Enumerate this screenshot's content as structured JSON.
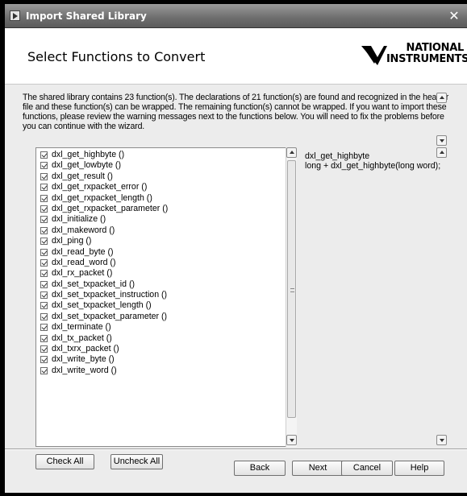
{
  "window": {
    "title": "Import Shared Library",
    "close_glyph": "✕"
  },
  "header": {
    "page_title": "Select Functions to Convert",
    "logo_line1": "NATIONAL",
    "logo_line2": "INSTRUMENTS"
  },
  "description": "The shared library contains 23 function(s). The declarations of 21 function(s) are found and recognized in the header file and these function(s) can be wrapped. The remaining function(s) cannot be wrapped. If you want to import these functions, please review the warning messages next to the functions below. You will need to fix the problems before you can continue with the wizard.",
  "functions": [
    {
      "label": "dxl_get_highbyte ()",
      "checked": true
    },
    {
      "label": "dxl_get_lowbyte ()",
      "checked": true
    },
    {
      "label": "dxl_get_result ()",
      "checked": true
    },
    {
      "label": "dxl_get_rxpacket_error ()",
      "checked": true
    },
    {
      "label": "dxl_get_rxpacket_length ()",
      "checked": true
    },
    {
      "label": "dxl_get_rxpacket_parameter ()",
      "checked": true
    },
    {
      "label": "dxl_initialize ()",
      "checked": true
    },
    {
      "label": "dxl_makeword ()",
      "checked": true
    },
    {
      "label": "dxl_ping ()",
      "checked": true
    },
    {
      "label": "dxl_read_byte ()",
      "checked": true
    },
    {
      "label": "dxl_read_word ()",
      "checked": true
    },
    {
      "label": "dxl_rx_packet ()",
      "checked": true
    },
    {
      "label": "dxl_set_txpacket_id ()",
      "checked": true
    },
    {
      "label": "dxl_set_txpacket_instruction ()",
      "checked": true
    },
    {
      "label": "dxl_set_txpacket_length ()",
      "checked": true
    },
    {
      "label": "dxl_set_txpacket_parameter ()",
      "checked": true
    },
    {
      "label": "dxl_terminate ()",
      "checked": true
    },
    {
      "label": "dxl_tx_packet ()",
      "checked": true
    },
    {
      "label": "dxl_txrx_packet ()",
      "checked": true
    },
    {
      "label": "dxl_write_byte ()",
      "checked": true
    },
    {
      "label": "dxl_write_word ()",
      "checked": true
    }
  ],
  "detail": {
    "function_name": "dxl_get_highbyte",
    "declaration": "long + dxl_get_highbyte(long word);"
  },
  "buttons": {
    "check_all": "Check All",
    "uncheck_all": "Uncheck All",
    "back": "Back",
    "next": "Next",
    "cancel": "Cancel",
    "help": "Help"
  }
}
